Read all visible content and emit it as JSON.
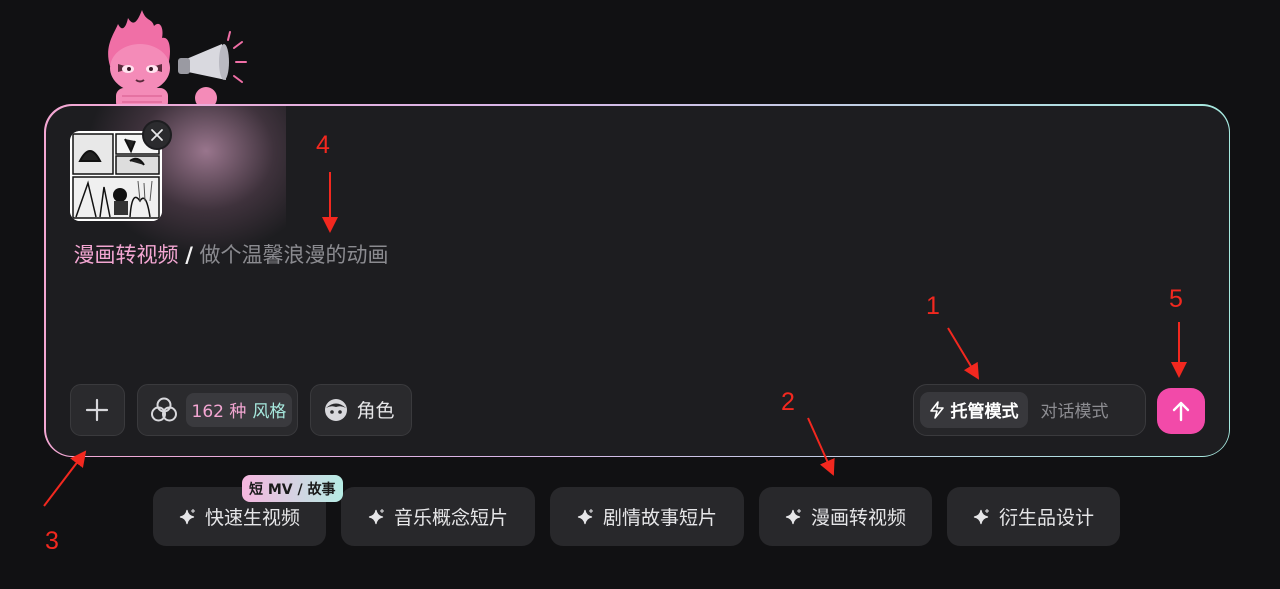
{
  "prompt": {
    "tag": "漫画转视频",
    "separator": "/",
    "text": "做个温馨浪漫的动画"
  },
  "toolbar": {
    "style_count": "162 种",
    "style_word": "风格",
    "role_label": "角色"
  },
  "mode": {
    "active": "托管模式",
    "inactive": "对话模式"
  },
  "chips": {
    "items": [
      {
        "label": "快速生视频",
        "icon": "sparkle-icon"
      },
      {
        "label": "音乐概念短片",
        "icon": "sparkle-icon"
      },
      {
        "label": "剧情故事短片",
        "icon": "sparkle-icon"
      },
      {
        "label": "漫画转视频",
        "icon": "sparkle-icon"
      },
      {
        "label": "衍生品设计",
        "icon": "sparkle-icon"
      }
    ],
    "badge": "短 MV / 故事"
  },
  "annotations": {
    "a1": "1",
    "a2": "2",
    "a3": "3",
    "a4": "4",
    "a5": "5"
  },
  "colors": {
    "accent_pink": "#f24aa9",
    "tag_pink": "#f3a6d2",
    "mint": "#a7e9de",
    "annotation_red": "#f2281f"
  }
}
